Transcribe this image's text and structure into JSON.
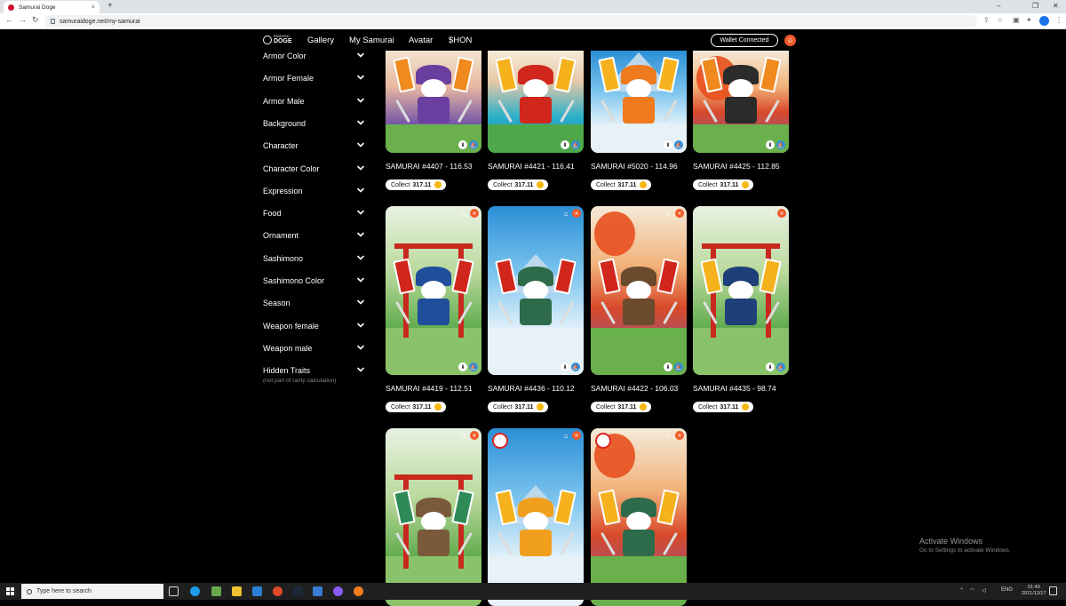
{
  "browser": {
    "tab_title": "Samurai Doge",
    "tab_close": "×",
    "new_tab": "+",
    "url": "samuraidoge.net/my-samurai",
    "nav": {
      "back": "←",
      "forward": "→",
      "reload": "↻"
    },
    "window_controls": {
      "minimize": "–",
      "maximize": "❐",
      "close": "✕"
    }
  },
  "site": {
    "logo_top": "SAMURAI",
    "logo_bottom": "DOGE",
    "nav": [
      "Gallery",
      "My Samurai",
      "Avatar",
      "$HON"
    ],
    "wallet_label": "Wallet Connected"
  },
  "filters": {
    "items": [
      "Armor Color",
      "Armor Female",
      "Armor Male",
      "Background",
      "Character",
      "Character Color",
      "Expression",
      "Food",
      "Ornament",
      "Sashimono",
      "Sashimono Color",
      "Season",
      "Weapon female",
      "Weapon male",
      "Hidden Traits"
    ],
    "note": "(not part of rarity calculation)"
  },
  "collect_label": "Collect",
  "cards": [
    {
      "title": "SAMURAI #4407 - 116.53",
      "amount": "317.11",
      "scene": "sunset-purple",
      "armor": "#6b3fa0",
      "banner": "#f08a1e"
    },
    {
      "title": "SAMURAI #4421 - 116.41",
      "amount": "317.11",
      "scene": "ocean",
      "armor": "#d0261c",
      "banner": "#f5b21c"
    },
    {
      "title": "SAMURAI #5020 - 114.96",
      "amount": "317.11",
      "scene": "snow",
      "armor": "#f07a1e",
      "banner": "#f5b21c"
    },
    {
      "title": "SAMURAI #4425 - 112.85",
      "amount": "317.11",
      "scene": "autumn",
      "armor": "#2b2b2b",
      "banner": "#f08a1e"
    },
    {
      "title": "SAMURAI #4419 - 112.51",
      "amount": "317.11",
      "scene": "bamboo",
      "armor": "#1f4f9a",
      "banner": "#d0261c"
    },
    {
      "title": "SAMURAI #4436 - 110.12",
      "amount": "317.11",
      "scene": "snow",
      "armor": "#2e6b4a",
      "banner": "#d0261c"
    },
    {
      "title": "SAMURAI #4422 - 106.03",
      "amount": "317.11",
      "scene": "autumn",
      "armor": "#6b4a2e",
      "banner": "#d0261c"
    },
    {
      "title": "SAMURAI #4435 - 98.74",
      "amount": "317.11",
      "scene": "bamboo",
      "armor": "#1f3f7a",
      "banner": "#f5b21c"
    },
    {
      "title": "",
      "amount": "",
      "scene": "bamboo",
      "armor": "#7a5a3a",
      "banner": "#2e8b57"
    },
    {
      "title": "",
      "amount": "",
      "scene": "snow",
      "armor": "#f0a01e",
      "banner": "#f5b21c"
    },
    {
      "title": "",
      "amount": "",
      "scene": "autumn",
      "armor": "#2e6b4a",
      "banner": "#f5b21c"
    }
  ],
  "watermark": {
    "title": "Activate Windows",
    "subtitle": "Go to Settings to activate Windows."
  },
  "taskbar": {
    "search_placeholder": "Type here to search",
    "lang": "ENG",
    "time": "01:49",
    "date": "2021/12/17"
  }
}
